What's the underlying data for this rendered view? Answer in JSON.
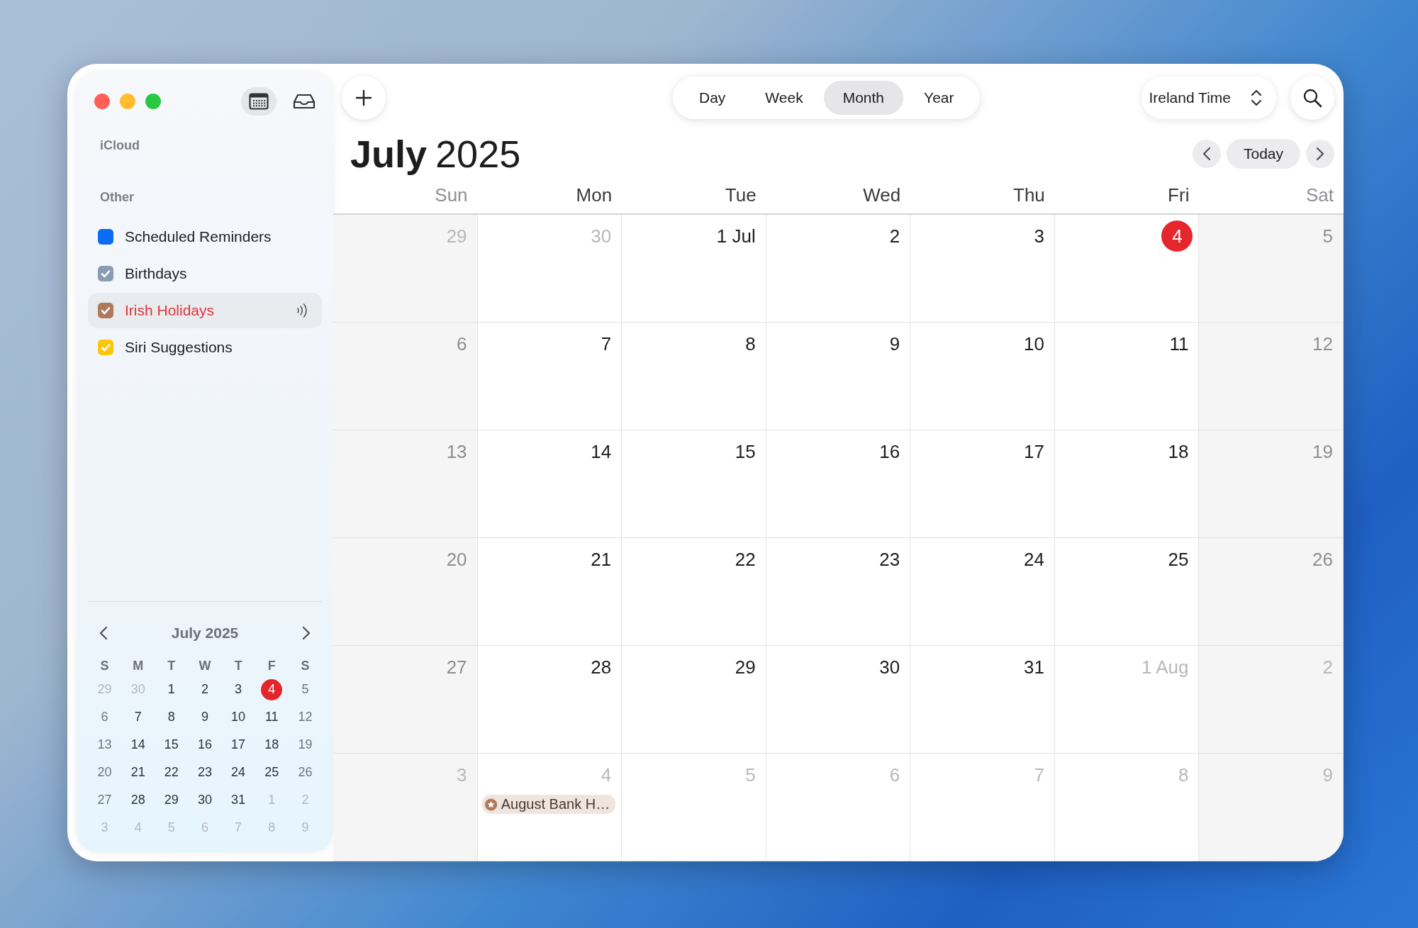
{
  "sidebar": {
    "sections": [
      {
        "title": "iCloud"
      },
      {
        "title": "Other",
        "items": [
          {
            "label": "Scheduled Reminders",
            "color": "#0a6cf5",
            "checked": false,
            "selected": false,
            "shared": false
          },
          {
            "label": "Birthdays",
            "color": "#8a9bb4",
            "checked": true,
            "selected": false,
            "shared": false
          },
          {
            "label": "Irish Holidays",
            "color": "#b07a5a",
            "checked": true,
            "selected": true,
            "shared": true
          },
          {
            "label": "Siri Suggestions",
            "color": "#fdc60a",
            "checked": true,
            "selected": false,
            "shared": false
          }
        ]
      }
    ]
  },
  "mini_calendar": {
    "title": "July 2025",
    "weekdays": [
      "S",
      "M",
      "T",
      "W",
      "T",
      "F",
      "S"
    ],
    "weeks": [
      [
        {
          "day": "29",
          "muted": true,
          "today": false
        },
        {
          "day": "30",
          "muted": true,
          "today": false
        },
        {
          "day": "1",
          "muted": false,
          "today": false
        },
        {
          "day": "2",
          "muted": false,
          "today": false
        },
        {
          "day": "3",
          "muted": false,
          "today": false
        },
        {
          "day": "4",
          "muted": false,
          "today": true
        },
        {
          "day": "5",
          "muted": false,
          "today": false
        }
      ],
      [
        {
          "day": "6",
          "muted": false,
          "today": false
        },
        {
          "day": "7",
          "muted": false,
          "today": false
        },
        {
          "day": "8",
          "muted": false,
          "today": false
        },
        {
          "day": "9",
          "muted": false,
          "today": false
        },
        {
          "day": "10",
          "muted": false,
          "today": false
        },
        {
          "day": "11",
          "muted": false,
          "today": false
        },
        {
          "day": "12",
          "muted": false,
          "today": false
        }
      ],
      [
        {
          "day": "13",
          "muted": false,
          "today": false
        },
        {
          "day": "14",
          "muted": false,
          "today": false
        },
        {
          "day": "15",
          "muted": false,
          "today": false
        },
        {
          "day": "16",
          "muted": false,
          "today": false
        },
        {
          "day": "17",
          "muted": false,
          "today": false
        },
        {
          "day": "18",
          "muted": false,
          "today": false
        },
        {
          "day": "19",
          "muted": false,
          "today": false
        }
      ],
      [
        {
          "day": "20",
          "muted": false,
          "today": false
        },
        {
          "day": "21",
          "muted": false,
          "today": false
        },
        {
          "day": "22",
          "muted": false,
          "today": false
        },
        {
          "day": "23",
          "muted": false,
          "today": false
        },
        {
          "day": "24",
          "muted": false,
          "today": false
        },
        {
          "day": "25",
          "muted": false,
          "today": false
        },
        {
          "day": "26",
          "muted": false,
          "today": false
        }
      ],
      [
        {
          "day": "27",
          "muted": false,
          "today": false
        },
        {
          "day": "28",
          "muted": false,
          "today": false
        },
        {
          "day": "29",
          "muted": false,
          "today": false
        },
        {
          "day": "30",
          "muted": false,
          "today": false
        },
        {
          "day": "31",
          "muted": false,
          "today": false
        },
        {
          "day": "1",
          "muted": true,
          "today": false
        },
        {
          "day": "2",
          "muted": true,
          "today": false
        }
      ],
      [
        {
          "day": "3",
          "muted": true,
          "today": false
        },
        {
          "day": "4",
          "muted": true,
          "today": false
        },
        {
          "day": "5",
          "muted": true,
          "today": false
        },
        {
          "day": "6",
          "muted": true,
          "today": false
        },
        {
          "day": "7",
          "muted": true,
          "today": false
        },
        {
          "day": "8",
          "muted": true,
          "today": false
        },
        {
          "day": "9",
          "muted": true,
          "today": false
        }
      ]
    ]
  },
  "toolbar": {
    "views": [
      {
        "label": "Day",
        "selected": false
      },
      {
        "label": "Week",
        "selected": false
      },
      {
        "label": "Month",
        "selected": true
      },
      {
        "label": "Year",
        "selected": false
      }
    ],
    "timezone": "Ireland Time"
  },
  "header": {
    "month": "July",
    "year": "2025",
    "today_button": "Today"
  },
  "month_grid": {
    "weekdays": [
      "Sun",
      "Mon",
      "Tue",
      "Wed",
      "Thu",
      "Fri",
      "Sat"
    ],
    "weeks": [
      [
        {
          "label": "29",
          "muted": true,
          "today": false
        },
        {
          "label": "30",
          "muted": true,
          "today": false
        },
        {
          "label": "1 Jul",
          "muted": false,
          "today": false
        },
        {
          "label": "2",
          "muted": false,
          "today": false
        },
        {
          "label": "3",
          "muted": false,
          "today": false
        },
        {
          "label": "4",
          "muted": false,
          "today": true
        },
        {
          "label": "5",
          "muted": false,
          "today": false
        }
      ],
      [
        {
          "label": "6",
          "muted": false,
          "today": false
        },
        {
          "label": "7",
          "muted": false,
          "today": false
        },
        {
          "label": "8",
          "muted": false,
          "today": false
        },
        {
          "label": "9",
          "muted": false,
          "today": false
        },
        {
          "label": "10",
          "muted": false,
          "today": false
        },
        {
          "label": "11",
          "muted": false,
          "today": false
        },
        {
          "label": "12",
          "muted": false,
          "today": false
        }
      ],
      [
        {
          "label": "13",
          "muted": false,
          "today": false
        },
        {
          "label": "14",
          "muted": false,
          "today": false
        },
        {
          "label": "15",
          "muted": false,
          "today": false
        },
        {
          "label": "16",
          "muted": false,
          "today": false
        },
        {
          "label": "17",
          "muted": false,
          "today": false
        },
        {
          "label": "18",
          "muted": false,
          "today": false
        },
        {
          "label": "19",
          "muted": false,
          "today": false
        }
      ],
      [
        {
          "label": "20",
          "muted": false,
          "today": false
        },
        {
          "label": "21",
          "muted": false,
          "today": false
        },
        {
          "label": "22",
          "muted": false,
          "today": false
        },
        {
          "label": "23",
          "muted": false,
          "today": false
        },
        {
          "label": "24",
          "muted": false,
          "today": false
        },
        {
          "label": "25",
          "muted": false,
          "today": false
        },
        {
          "label": "26",
          "muted": false,
          "today": false
        }
      ],
      [
        {
          "label": "27",
          "muted": false,
          "today": false
        },
        {
          "label": "28",
          "muted": false,
          "today": false
        },
        {
          "label": "29",
          "muted": false,
          "today": false
        },
        {
          "label": "30",
          "muted": false,
          "today": false
        },
        {
          "label": "31",
          "muted": false,
          "today": false
        },
        {
          "label": "1 Aug",
          "muted": true,
          "today": false
        },
        {
          "label": "2",
          "muted": true,
          "today": false
        }
      ],
      [
        {
          "label": "3",
          "muted": true,
          "today": false
        },
        {
          "label": "4",
          "muted": true,
          "today": false,
          "events": [
            {
              "title": "August Bank H…",
              "color": "#b07a5a"
            }
          ]
        },
        {
          "label": "5",
          "muted": true,
          "today": false
        },
        {
          "label": "6",
          "muted": true,
          "today": false
        },
        {
          "label": "7",
          "muted": true,
          "today": false
        },
        {
          "label": "8",
          "muted": true,
          "today": false
        },
        {
          "label": "9",
          "muted": true,
          "today": false
        }
      ]
    ]
  }
}
